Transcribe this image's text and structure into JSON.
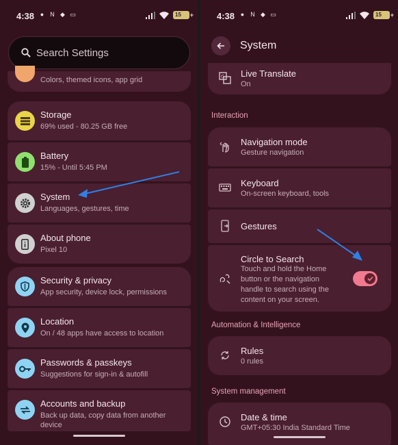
{
  "status": {
    "time": "4:38",
    "battery": "15"
  },
  "left": {
    "search_placeholder": "Search Settings",
    "partial_item": {
      "subtitle": "Colors, themed icons, app grid"
    },
    "group1": [
      {
        "title": "Storage",
        "subtitle": "69% used - 80.25 GB free",
        "icon": "storage-icon",
        "color": "#e9d44a"
      },
      {
        "title": "Battery",
        "subtitle": "15% - Until 5:45 PM",
        "icon": "battery-icon",
        "color": "#8fe06f"
      },
      {
        "title": "System",
        "subtitle": "Languages, gestures, time",
        "icon": "gear-icon",
        "color": "#d0d0d0"
      },
      {
        "title": "About phone",
        "subtitle": "Pixel 10",
        "icon": "phone-info-icon",
        "color": "#d0d0d0"
      }
    ],
    "group2": [
      {
        "title": "Security & privacy",
        "subtitle": "App security, device lock, permissions",
        "icon": "shield-icon",
        "color": "#8fd3f4"
      },
      {
        "title": "Location",
        "subtitle": "On / 48 apps have access to location",
        "icon": "location-icon",
        "color": "#8fd3f4"
      },
      {
        "title": "Passwords & passkeys",
        "subtitle": "Suggestions for sign-in & autofill",
        "icon": "key-icon",
        "color": "#8fd3f4"
      },
      {
        "title": "Accounts and backup",
        "subtitle": "Back up data, copy data from another",
        "subtitle2": "device",
        "icon": "sync-icon",
        "color": "#8fd3f4"
      }
    ]
  },
  "right": {
    "title": "System",
    "live_translate": {
      "title": "Live Translate",
      "subtitle": "On"
    },
    "interaction_label": "Interaction",
    "interaction": [
      {
        "title": "Navigation mode",
        "subtitle": "Gesture navigation"
      },
      {
        "title": "Keyboard",
        "subtitle": "On-screen keyboard, tools"
      },
      {
        "title": "Gestures",
        "subtitle": ""
      }
    ],
    "circle": {
      "title": "Circle to Search",
      "lines": [
        "Touch and hold the Home",
        "button or the navigation",
        "handle to search using the",
        "content on your screen."
      ],
      "enabled": true
    },
    "automation_label": "Automation & Intelligence",
    "rules": {
      "title": "Rules",
      "subtitle": "0 rules"
    },
    "sysmgmt_label": "System management",
    "datetime": {
      "title": "Date & time",
      "subtitle": "GMT+05:30 India Standard Time"
    }
  },
  "colors": {
    "bg": "#33121e",
    "card": "#4a1f2f",
    "accent": "#e8a2b4",
    "toggle": "#f07a8f",
    "arrow": "#2f7fe6"
  }
}
